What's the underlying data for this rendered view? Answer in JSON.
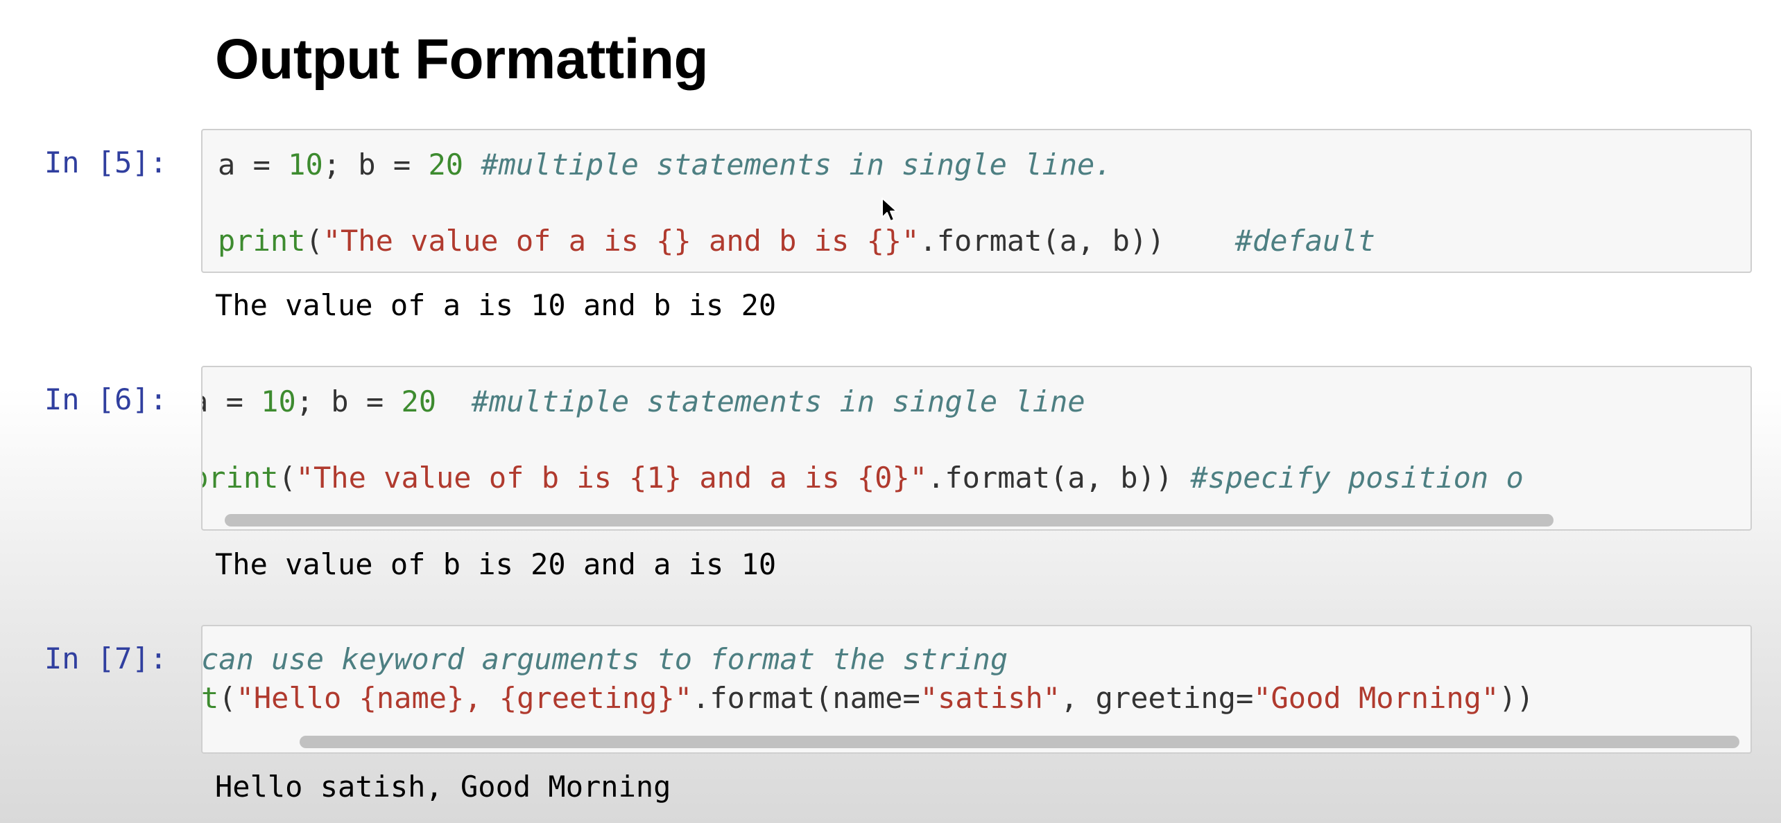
{
  "page": {
    "heading": "Output Formatting"
  },
  "cells": [
    {
      "prompt": "In [5]:",
      "lines": [
        [
          {
            "t": "a = ",
            "c": "op"
          },
          {
            "t": "10",
            "c": "num"
          },
          {
            "t": "; b = ",
            "c": "op"
          },
          {
            "t": "20",
            "c": "num"
          },
          {
            "t": " ",
            "c": "op"
          },
          {
            "t": "#multiple statements in single line.",
            "c": "cm"
          }
        ],
        [
          {
            "t": "print",
            "c": "bi"
          },
          {
            "t": "(",
            "c": "op"
          },
          {
            "t": "\"The value of a is {} and b is {}\"",
            "c": "str"
          },
          {
            "t": ".format(a, b))    ",
            "c": "op"
          },
          {
            "t": "#default",
            "c": "cm"
          }
        ]
      ],
      "output": "The value of a is 10 and b is 20"
    },
    {
      "prompt": "In [6]:",
      "lines": [
        [
          {
            "t": "a = ",
            "c": "op"
          },
          {
            "t": "10",
            "c": "num"
          },
          {
            "t": "; b = ",
            "c": "op"
          },
          {
            "t": "20",
            "c": "num"
          },
          {
            "t": "  ",
            "c": "op"
          },
          {
            "t": "#multiple statements in single line",
            "c": "cm"
          }
        ],
        [
          {
            "t": "print",
            "c": "bi"
          },
          {
            "t": "(",
            "c": "op"
          },
          {
            "t": "\"The value of b is {1} and a is {0}\"",
            "c": "str"
          },
          {
            "t": ".format(a, b)) ",
            "c": "op"
          },
          {
            "t": "#specify position o",
            "c": "cm"
          }
        ]
      ],
      "output": "The value of b is 20 and a is 10"
    },
    {
      "prompt": "In [7]:",
      "lines": [
        [
          {
            "t": "can use keyword arguments to format the string",
            "c": "cm"
          }
        ],
        [
          {
            "t": "t",
            "c": "bi"
          },
          {
            "t": "(",
            "c": "op"
          },
          {
            "t": "\"Hello {name}, {greeting}\"",
            "c": "str"
          },
          {
            "t": ".format(name=",
            "c": "op"
          },
          {
            "t": "\"satish\"",
            "c": "str"
          },
          {
            "t": ", greeting=",
            "c": "op"
          },
          {
            "t": "\"Good Morning\"",
            "c": "str"
          },
          {
            "t": "))",
            "c": "op"
          }
        ]
      ],
      "output": "Hello satish, Good Morning"
    }
  ],
  "colors": {
    "prompt": "#303f9f",
    "number": "#3d8b2f",
    "string": "#b03a2e",
    "builtin": "#3d8b2f",
    "comment": "#4d7f82",
    "cell_background": "#f7f7f7",
    "cell_border": "#cfcfcf"
  },
  "icons": {
    "cursor": "mouse-pointer-icon"
  }
}
